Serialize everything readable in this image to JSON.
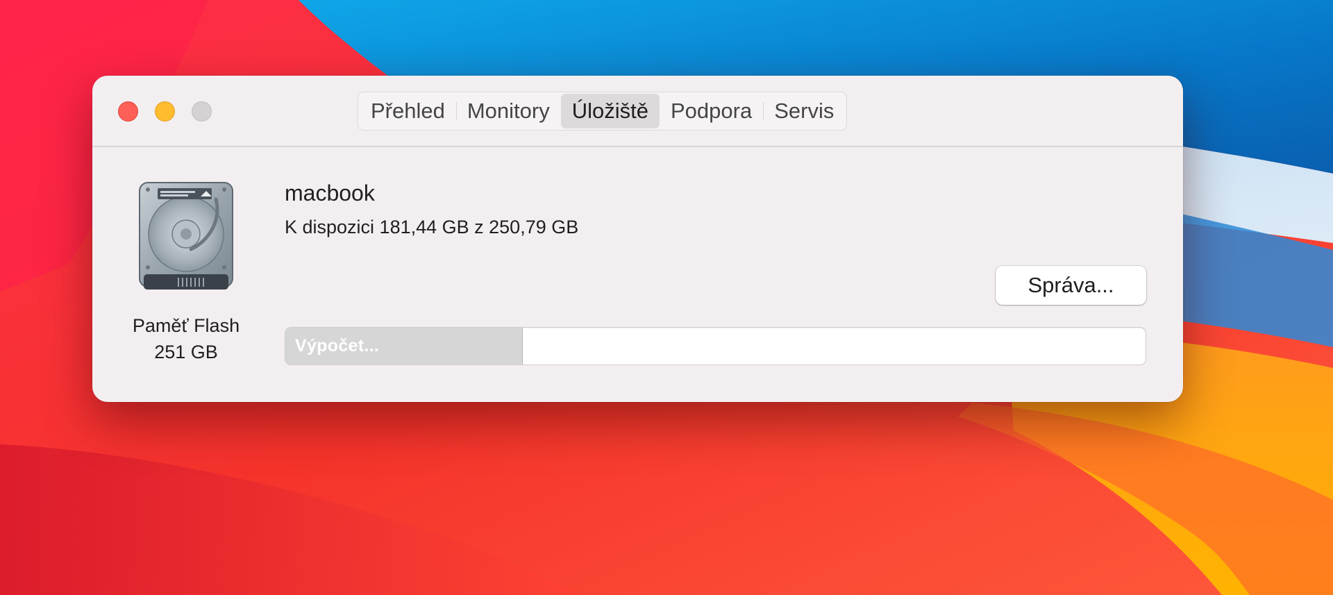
{
  "window": {
    "tabs": [
      {
        "label": "Přehled",
        "selected": false
      },
      {
        "label": "Monitory",
        "selected": false
      },
      {
        "label": "Úložiště",
        "selected": true
      },
      {
        "label": "Podpora",
        "selected": false
      },
      {
        "label": "Servis",
        "selected": false
      }
    ]
  },
  "disk": {
    "icon": "hard-drive-icon",
    "type_label": "Paměť Flash",
    "capacity_label": "251 GB"
  },
  "volume": {
    "name": "macbook",
    "available": "K dispozici 181,44 GB z 250,79 GB",
    "manage_label": "Správa...",
    "bar_label": "Výpočet...",
    "bar_fill_fraction": 0.276
  },
  "colors": {
    "close": "#fe5f57",
    "minimize": "#febc2e",
    "zoom_inactive": "#d6d2d3",
    "window_bg": "#f3eff0"
  }
}
